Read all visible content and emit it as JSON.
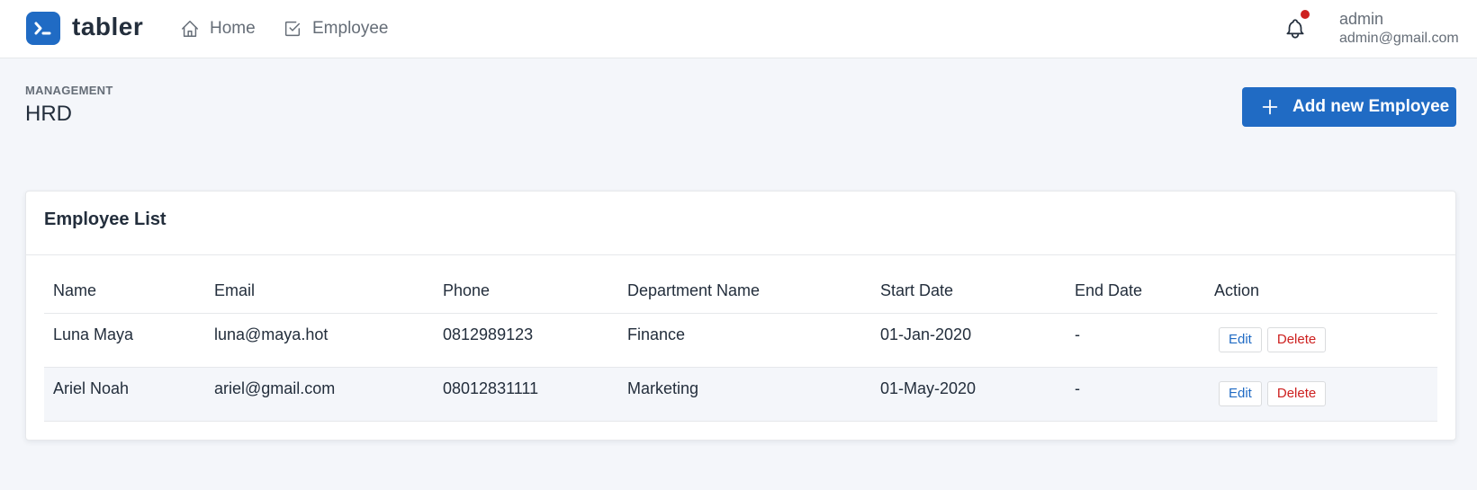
{
  "brand": {
    "name": "tabler"
  },
  "nav": [
    {
      "label": "Home",
      "icon": "home-icon"
    },
    {
      "label": "Employee",
      "icon": "checkbox-icon"
    }
  ],
  "user": {
    "name": "admin",
    "email": "admin@gmail.com",
    "has_notification": true
  },
  "page": {
    "pretitle": "MANAGEMENT",
    "title": "HRD"
  },
  "actions": {
    "add_label": "Add new Employee"
  },
  "card": {
    "title": "Employee List"
  },
  "table": {
    "columns": [
      "Name",
      "Email",
      "Phone",
      "Department Name",
      "Start Date",
      "End Date",
      "Action"
    ],
    "rows": [
      {
        "name": "Luna Maya",
        "email": "luna@maya.hot",
        "phone": "0812989123",
        "department": "Finance",
        "start": "01-Jan-2020",
        "end": "-",
        "edit": "Edit",
        "delete": "Delete"
      },
      {
        "name": "Ariel Noah",
        "email": "ariel@gmail.com",
        "phone": "08012831111",
        "department": "Marketing",
        "start": "01-May-2020",
        "end": "-",
        "edit": "Edit",
        "delete": "Delete"
      }
    ]
  },
  "colors": {
    "primary": "#206bc4",
    "danger": "#cd201f",
    "muted": "#656d77",
    "background": "#f4f6fa"
  }
}
